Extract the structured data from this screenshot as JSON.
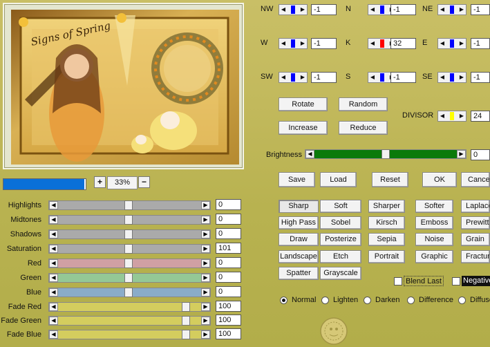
{
  "preview": {
    "title_text": "Signs of Spring"
  },
  "zoom": {
    "plus": "+",
    "value": "33%",
    "minus": "−",
    "progress": 0.98
  },
  "adjust": [
    {
      "label": "Highlights",
      "value": "0",
      "track": "#aaaaaa"
    },
    {
      "label": "Midtones",
      "value": "0",
      "track": "#aaaaaa"
    },
    {
      "label": "Shadows",
      "value": "0",
      "track": "#aaaaaa"
    },
    {
      "label": "Saturation",
      "value": "101",
      "track": "#aaaaaa"
    },
    {
      "label": "Red",
      "value": "0",
      "track": "#d0a0a4"
    },
    {
      "label": "Green",
      "value": "0",
      "track": "#94c896"
    },
    {
      "label": "Blue",
      "value": "0",
      "track": "#8aacc8"
    },
    {
      "label": "Fade Red",
      "value": "100",
      "track": "#d4cd5e"
    },
    {
      "label": "Fade Green",
      "value": "100",
      "track": "#d4cd5e"
    },
    {
      "label": "Fade Blue",
      "value": "100",
      "track": "#d4cd5e"
    }
  ],
  "kernel": [
    {
      "label": "NW",
      "value": "-1",
      "color": "#0000ff"
    },
    {
      "label": "N",
      "value": "-1",
      "color": "#0000ff"
    },
    {
      "label": "NE",
      "value": "-1",
      "color": "#0000ff"
    },
    {
      "label": "W",
      "value": "-1",
      "color": "#0000ff"
    },
    {
      "label": "K",
      "value": "32",
      "color": "#ff0000"
    },
    {
      "label": "E",
      "value": "-1",
      "color": "#0000ff"
    },
    {
      "label": "SW",
      "value": "-1",
      "color": "#0000ff"
    },
    {
      "label": "S",
      "value": "-1",
      "color": "#0000ff"
    },
    {
      "label": "SE",
      "value": "-1",
      "color": "#0000ff"
    }
  ],
  "kernel_buttons": {
    "rotate": "Rotate",
    "random": "Random",
    "increase": "Increase",
    "reduce": "Reduce"
  },
  "divisor": {
    "label": "DIVISOR",
    "value": "24",
    "color": "#ffff00"
  },
  "brightness": {
    "label": "Brightness",
    "value": "0",
    "track": "#0a7a0a"
  },
  "actions": {
    "save": "Save",
    "load": "Load",
    "reset": "Reset",
    "ok": "OK",
    "cancel": "Cancel"
  },
  "presets": [
    [
      "Sharp",
      "Soft",
      "Sharper",
      "Softer",
      "Laplace"
    ],
    [
      "High Pass",
      "Sobel",
      "Kirsch",
      "Emboss",
      "Prewitt"
    ],
    [
      "Draw",
      "Posterize",
      "Sepia",
      "Noise",
      "Grain"
    ],
    [
      "Landscape",
      "Etch",
      "Portrait",
      "Graphic",
      "Fractures"
    ],
    [
      "Spatter",
      "Grayscale"
    ]
  ],
  "options": {
    "blend_last": "Blend Last",
    "negative": "Negative"
  },
  "modes": [
    "Normal",
    "Lighten",
    "Darken",
    "Difference",
    "Diffuse"
  ]
}
